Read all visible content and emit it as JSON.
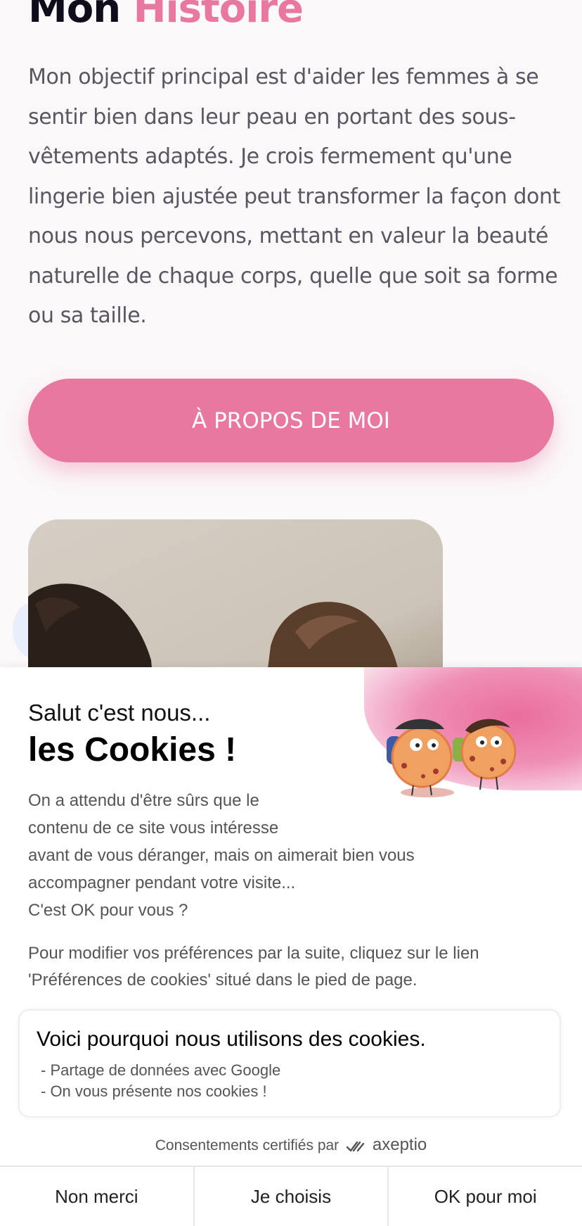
{
  "header": {
    "title_part1": "Mon",
    "title_part2": "Histoire"
  },
  "story": {
    "text": "Mon objectif principal est d'aider les femmes à se sentir bien dans leur peau en portant des sous-vêtements adaptés. Je crois fermement qu'une lingerie bien ajustée peut transformer la façon dont nous nous percevons, mettant en valeur la beauté naturelle de chaque corps, quelle que soit sa forme ou sa taille."
  },
  "about_button": {
    "label": "À PROPOS DE MOI"
  },
  "cookie_banner": {
    "greeting": "Salut c'est nous...",
    "title": "les Cookies !",
    "body": [
      "On a attendu d'être sûrs que le",
      "contenu de ce site vous intéresse",
      "avant de vous déranger, mais on aimerait bien vous",
      "accompagner pendant votre visite...",
      "C'est OK pour vous ?"
    ],
    "preferences_note": "Pour modifier vos préférences par la suite, cliquez sur le lien 'Préférences de cookies' situé dans le pied de page.",
    "reasons_title": "Voici pourquoi nous utilisons des cookies.",
    "reasons": [
      "- Partage de données avec Google",
      "- On vous présente nos cookies !"
    ],
    "certified_text": "Consentements certifiés par",
    "brand": "axeptio",
    "buttons": {
      "decline": "Non merci",
      "choose": "Je choisis",
      "accept": "OK pour moi"
    }
  },
  "colors": {
    "accent": "#e878a0",
    "heading": "#0f0c1c",
    "text": "#5a5560"
  },
  "icons": [
    "cookie-mascots-illustration",
    "axeptio-logo-icon"
  ]
}
